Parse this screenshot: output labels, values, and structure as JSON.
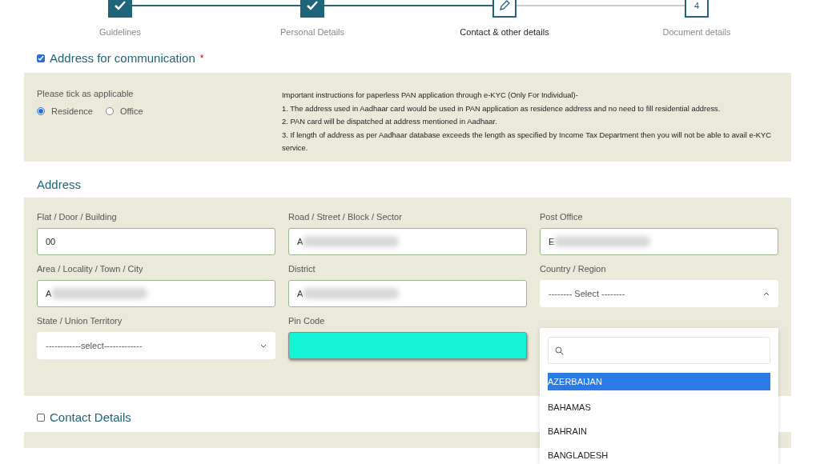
{
  "stepper": {
    "steps": [
      {
        "label": "Guidelines",
        "kind": "done"
      },
      {
        "label": "Personal Details",
        "kind": "done"
      },
      {
        "label": "Contact & other details",
        "kind": "current"
      },
      {
        "label": "Document details",
        "kind": "pending",
        "number": "4"
      }
    ]
  },
  "communication": {
    "title": "Address for communication",
    "required_mark": "*",
    "checked": true,
    "tick_label": "Please tick as applicable",
    "options": [
      {
        "label": "Residence",
        "selected": true
      },
      {
        "label": "Office",
        "selected": false
      }
    ],
    "instructions": [
      "Important instructions for paperless PAN application through e-KYC (Only For Individual)-",
      "1. The address used in Aadhaar card would be used in PAN application as residence address and no need to fill residential address.",
      "2. PAN card will be dispatched at address mentioned in Aadhaar.",
      "3. If length of address as per Aadhaar database exceeds the length as specified by Income Tax Department then you will not be able to avail e-KYC service."
    ]
  },
  "address": {
    "heading": "Address",
    "fields": [
      {
        "label": "Flat / Door / Building",
        "kind": "text",
        "value": "00",
        "redacted": false
      },
      {
        "label": "Road / Street / Block / Sector",
        "kind": "text",
        "value": "A",
        "redacted": true
      },
      {
        "label": "Post Office",
        "kind": "text",
        "value": "E",
        "redacted": true
      },
      {
        "label": "Area / Locality / Town / City",
        "kind": "text",
        "value": "A",
        "redacted": true
      },
      {
        "label": "District",
        "kind": "text",
        "value": "A",
        "redacted": true
      },
      {
        "label": "Country / Region",
        "kind": "select",
        "value": "-------- Select --------",
        "expanded": true,
        "options": [
          {
            "label": "AZERBAIJAN",
            "selected": true
          },
          {
            "label": "BAHAMAS",
            "selected": false
          },
          {
            "label": "BAHRAIN",
            "selected": false
          },
          {
            "label": "BANGLADESH",
            "selected": false
          }
        ]
      },
      {
        "label": "State / Union Territory",
        "kind": "select",
        "value": "------------select-------------",
        "expanded": false
      },
      {
        "label": "Pin Code",
        "kind": "highlighted"
      }
    ]
  },
  "contact": {
    "title": "Contact Details",
    "checked": false
  }
}
